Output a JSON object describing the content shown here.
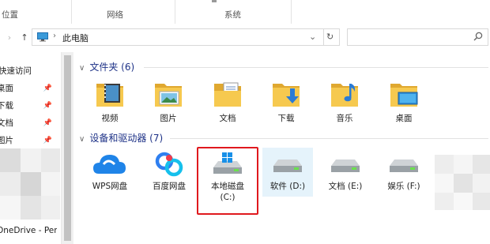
{
  "ribbon": {
    "groups": [
      "位置",
      "网络",
      "系统"
    ]
  },
  "address": {
    "path_label": "此电脑",
    "back": "‹",
    "forward": "›",
    "up": "↑",
    "dropdown": "⌄",
    "refresh": "↻",
    "search_placeholder": ""
  },
  "nav": {
    "items": [
      {
        "label": "快速访问",
        "pinned": false
      },
      {
        "label": "桌面",
        "pinned": true
      },
      {
        "label": "下载",
        "pinned": true
      },
      {
        "label": "文档",
        "pinned": true
      },
      {
        "label": "图片",
        "pinned": true
      }
    ],
    "onedrive": "OneDrive - Personal"
  },
  "folders_section": {
    "title": "文件夹 (6)"
  },
  "folders": [
    {
      "label": "视频",
      "icon": "video-folder-icon"
    },
    {
      "label": "图片",
      "icon": "pictures-folder-icon"
    },
    {
      "label": "文档",
      "icon": "documents-folder-icon"
    },
    {
      "label": "下载",
      "icon": "downloads-folder-icon"
    },
    {
      "label": "音乐",
      "icon": "music-folder-icon"
    },
    {
      "label": "桌面",
      "icon": "desktop-folder-icon"
    }
  ],
  "devices_section": {
    "title": "设备和驱动器 (7)"
  },
  "devices": [
    {
      "label": "WPS网盘",
      "label2": "",
      "icon": "wps-cloud-icon"
    },
    {
      "label": "百度网盘",
      "label2": "",
      "icon": "baidu-netdisk-icon"
    },
    {
      "label": "本地磁盘",
      "label2": "(C:)",
      "icon": "windows-drive-icon"
    },
    {
      "label": "软件 (D:)",
      "label2": "",
      "icon": "drive-icon"
    },
    {
      "label": "文档 (E:)",
      "label2": "",
      "icon": "drive-icon"
    },
    {
      "label": "娱乐 (F:)",
      "label2": "",
      "icon": "drive-icon"
    }
  ],
  "colors": {
    "highlight_box": "#e0191e",
    "folder": "#f6c94f",
    "section_text": "#1e3287",
    "selected_bg": "#e5f3fb"
  }
}
